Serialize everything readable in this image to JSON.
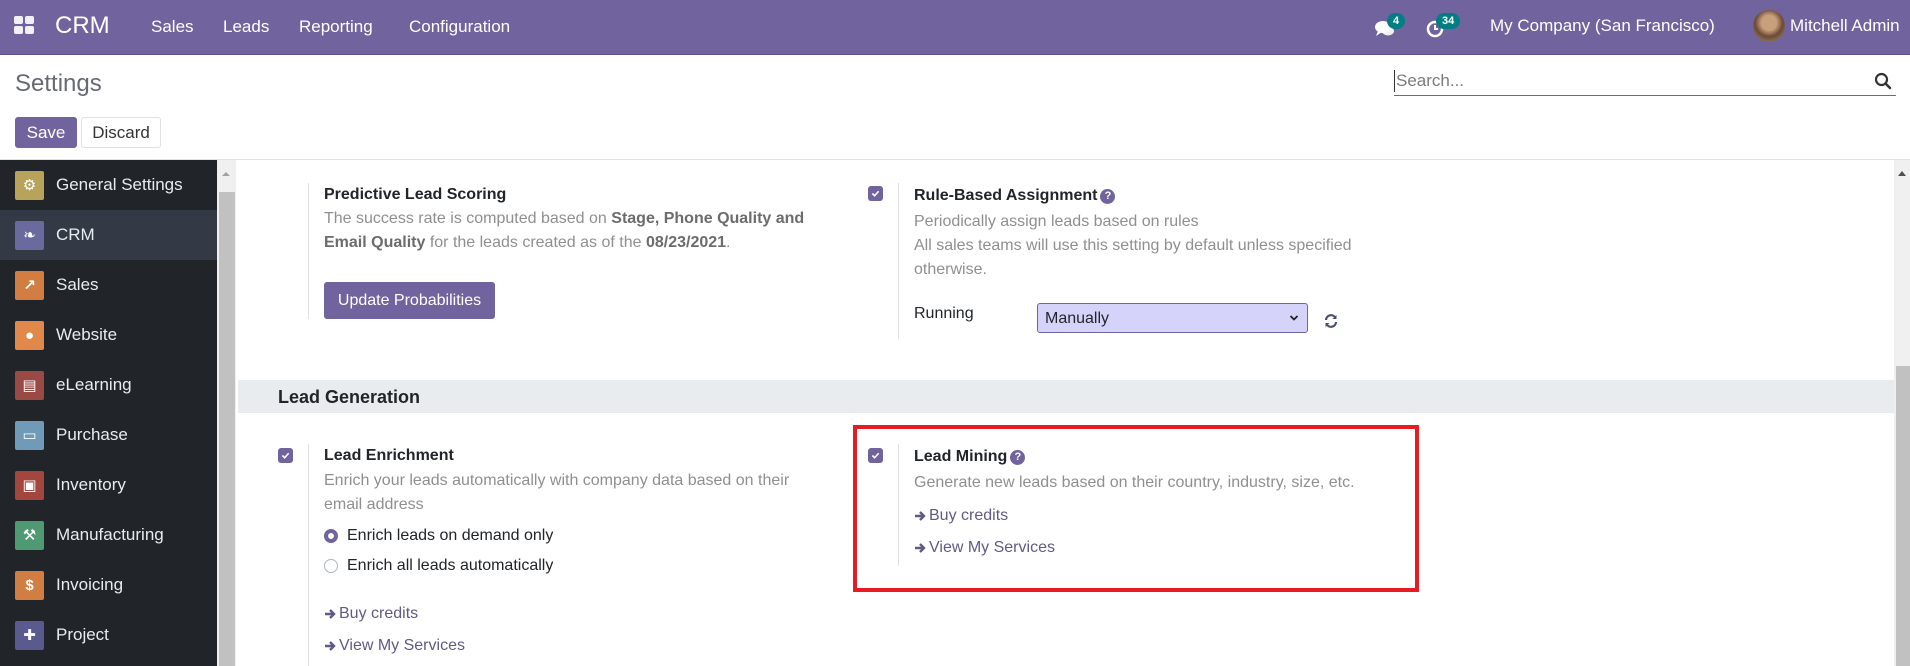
{
  "navbar": {
    "app_name": "CRM",
    "menu": [
      "Sales",
      "Leads",
      "Reporting",
      "Configuration"
    ],
    "messages_count": "4",
    "activities_count": "34",
    "company": "My Company (San Francisco)",
    "user": "Mitchell Admin"
  },
  "control_panel": {
    "title": "Settings",
    "save_label": "Save",
    "discard_label": "Discard",
    "search_placeholder": "Search..."
  },
  "sidebar": {
    "items": [
      {
        "label": "General Settings",
        "icon": "gear-icon",
        "color": "#b8a35a",
        "active": false
      },
      {
        "label": "CRM",
        "icon": "handshake-icon",
        "color": "#6a6a9f",
        "active": true
      },
      {
        "label": "Sales",
        "icon": "chart-up-icon",
        "color": "#d27d42",
        "active": false
      },
      {
        "label": "Website",
        "icon": "globe-icon",
        "color": "#e0894a",
        "active": false
      },
      {
        "label": "eLearning",
        "icon": "presentation-icon",
        "color": "#9a4a45",
        "active": false
      },
      {
        "label": "Purchase",
        "icon": "credit-card-icon",
        "color": "#6f9ab8",
        "active": false
      },
      {
        "label": "Inventory",
        "icon": "box-icon",
        "color": "#a3463d",
        "active": false
      },
      {
        "label": "Manufacturing",
        "icon": "wrench-icon",
        "color": "#4f9a73",
        "active": false
      },
      {
        "label": "Invoicing",
        "icon": "invoice-icon",
        "color": "#d27d42",
        "active": false
      },
      {
        "label": "Project",
        "icon": "puzzle-icon",
        "color": "#5b5a8f",
        "active": false
      }
    ]
  },
  "content": {
    "predictive": {
      "title": "Predictive Lead Scoring",
      "text_1": "The success rate is computed based on ",
      "bold_1": "Stage, Phone Quality and",
      "bold_2": "Email Quality",
      "text_2": " for the leads created as of the ",
      "bold_date": "08/23/2021",
      "text_3": ".",
      "button": "Update Probabilities"
    },
    "rule_based": {
      "title": "Rule-Based Assignment",
      "checked": true,
      "line_1": "Periodically assign leads based on rules",
      "line_2": "All sales teams will use this setting by default unless specified",
      "line_3": "otherwise.",
      "running_label": "Running",
      "running_value": "Manually"
    },
    "section_title": "Lead Generation",
    "enrichment": {
      "title": "Lead Enrichment",
      "checked": true,
      "line_1": "Enrich your leads automatically with company data based on their",
      "line_2": "email address",
      "options": [
        {
          "label": "Enrich leads on demand only",
          "selected": true
        },
        {
          "label": "Enrich all leads automatically",
          "selected": false
        }
      ],
      "link_buy": "Buy credits",
      "link_services": "View My Services"
    },
    "mining": {
      "title": "Lead Mining",
      "checked": true,
      "text": "Generate new leads based on their country, industry, size, etc.",
      "link_buy": "Buy credits",
      "link_services": "View My Services"
    }
  },
  "colors": {
    "brand": "#71639e",
    "badge": "#017e84",
    "highlight": "#e61b23",
    "sidebar_bg": "#212529"
  }
}
